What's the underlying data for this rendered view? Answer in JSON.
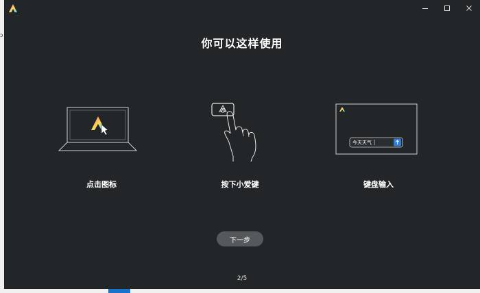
{
  "background": {
    "glyph": "ↄ"
  },
  "window": {
    "controls": {
      "minimize": "—",
      "close": "✕"
    }
  },
  "page": {
    "title": "你可以这样使用",
    "steps": [
      {
        "label": "点击图标",
        "illustration": "laptop-icon"
      },
      {
        "label": "按下小爱键",
        "illustration": "hand-pressing-key-icon"
      },
      {
        "label": "键盘输入",
        "illustration": "keyboard-input-window-icon",
        "input_text": "今天天气"
      }
    ],
    "next_button": "下一步",
    "page_indicator": "2/5"
  },
  "colors": {
    "window_bg": "#232628",
    "button_bg": "#55595c",
    "accent_blue": "#2f7fd8"
  }
}
